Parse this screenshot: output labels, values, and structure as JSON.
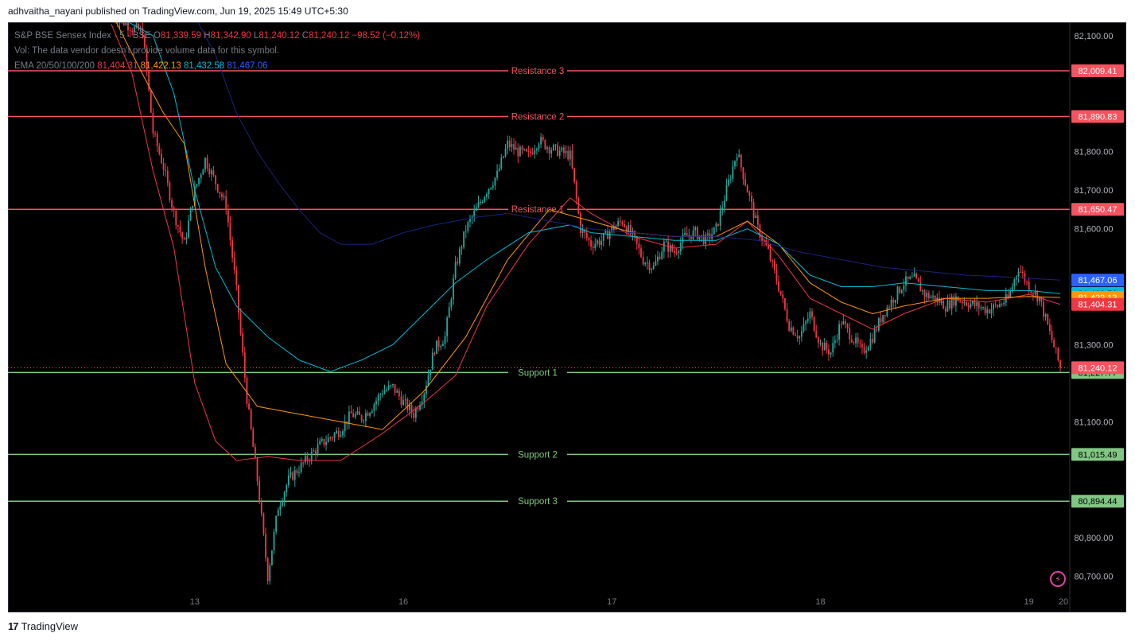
{
  "header": {
    "published_by": "adhvaitha_nayani published on TradingView.com, Jun 19, 2025 15:49 UTC+5:30"
  },
  "legend": {
    "symbol": "S&P BSE Sensex Index · 5 · BSE",
    "ohlc": {
      "o": "81,339.59",
      "h": "81,342.90",
      "l": "81,240.12",
      "c": "81,240.12",
      "change": "−98.52 (−0.12%)"
    },
    "vol_note": "Vol: The data vendor doesn't provide volume data for this symbol.",
    "ema_label": "EMA 20/50/100/200",
    "ema_values": [
      "81,404.31",
      "81,422.13",
      "81,432.58",
      "81,467.06"
    ]
  },
  "footer": {
    "brand_logo": "17",
    "brand_name": "TradingView"
  },
  "colors": {
    "background": "#000000",
    "up": "#26a69a",
    "down": "#f23645",
    "resistance": "#f7525f",
    "support": "#81c784",
    "ema20": "#f23645",
    "ema50": "#ff9800",
    "ema100": "#00bcd4",
    "ema200": "#1a237e"
  },
  "chart_data": {
    "type": "candlestick",
    "title": "S&P BSE Sensex Index · 5 · BSE",
    "ylim": [
      80660,
      82135
    ],
    "y_ticks": [
      "82,100.00",
      "81,800.00",
      "81,700.00",
      "81,600.00",
      "81,300.00",
      "81,100.00",
      "80,800.00",
      "80,700.00"
    ],
    "x_ticks": [
      "13",
      "16",
      "17",
      "18",
      "19",
      "20"
    ],
    "levels": [
      {
        "name": "Resistance 3",
        "value": 82009.41,
        "label": "82,009.41",
        "kind": "resistance"
      },
      {
        "name": "Resistance 2",
        "value": 81890.83,
        "label": "81,890.83",
        "kind": "resistance"
      },
      {
        "name": "Resistance 1",
        "value": 81650.47,
        "label": "81,650.47",
        "kind": "resistance"
      },
      {
        "name": "Support 1",
        "value": 81227.77,
        "label": "81,227.77",
        "kind": "support"
      },
      {
        "name": "Support 2",
        "value": 81015.49,
        "label": "81,015.49",
        "kind": "support"
      },
      {
        "name": "Support 3",
        "value": 80894.44,
        "label": "80,894.44",
        "kind": "support"
      }
    ],
    "price_tags": [
      {
        "value": 81467.06,
        "label": "81,467.06",
        "color": "#2962ff"
      },
      {
        "value": 81432.58,
        "label": "81,432.58",
        "color": "#00bcd4"
      },
      {
        "value": 81422.13,
        "label": "81,422.13",
        "color": "#ff9800"
      },
      {
        "value": 81404.31,
        "label": "81,404.31",
        "color": "#f23645"
      },
      {
        "value": 81240.12,
        "label": "81,240.12",
        "color": "#f7525f"
      }
    ],
    "last_price": 81240.12,
    "price_path": [
      [
        0,
        82155
      ],
      [
        1,
        82140
      ],
      [
        2,
        82120
      ],
      [
        3,
        82110
      ],
      [
        4,
        81850
      ],
      [
        5,
        81760
      ],
      [
        6,
        81640
      ],
      [
        7,
        81560
      ],
      [
        8,
        81700
      ],
      [
        9,
        81780
      ],
      [
        10,
        81720
      ],
      [
        11,
        81660
      ],
      [
        12,
        81440
      ],
      [
        13,
        81160
      ],
      [
        14,
        80950
      ],
      [
        15,
        80700
      ],
      [
        16,
        80880
      ],
      [
        17,
        80950
      ],
      [
        18,
        80980
      ],
      [
        19,
        81010
      ],
      [
        20,
        81040
      ],
      [
        21,
        81060
      ],
      [
        22,
        81080
      ],
      [
        23,
        81120
      ],
      [
        24,
        81110
      ],
      [
        25,
        81140
      ],
      [
        26,
        81180
      ],
      [
        27,
        81190
      ],
      [
        28,
        81150
      ],
      [
        29,
        81120
      ],
      [
        30,
        81180
      ],
      [
        31,
        81290
      ],
      [
        32,
        81320
      ],
      [
        33,
        81500
      ],
      [
        34,
        81600
      ],
      [
        35,
        81650
      ],
      [
        36,
        81700
      ],
      [
        37,
        81740
      ],
      [
        38,
        81820
      ],
      [
        39,
        81800
      ],
      [
        40,
        81790
      ],
      [
        41,
        81830
      ],
      [
        42,
        81810
      ],
      [
        43,
        81800
      ],
      [
        44,
        81790
      ],
      [
        45,
        81600
      ],
      [
        46,
        81560
      ],
      [
        47,
        81570
      ],
      [
        48,
        81600
      ],
      [
        49,
        81620
      ],
      [
        50,
        81580
      ],
      [
        51,
        81520
      ],
      [
        52,
        81500
      ],
      [
        53,
        81560
      ],
      [
        54,
        81540
      ],
      [
        55,
        81580
      ],
      [
        56,
        81590
      ],
      [
        57,
        81570
      ],
      [
        58,
        81600
      ],
      [
        59,
        81700
      ],
      [
        60,
        81800
      ],
      [
        61,
        81700
      ],
      [
        62,
        81600
      ],
      [
        63,
        81540
      ],
      [
        64,
        81450
      ],
      [
        65,
        81350
      ],
      [
        66,
        81320
      ],
      [
        67,
        81380
      ],
      [
        68,
        81300
      ],
      [
        69,
        81280
      ],
      [
        70,
        81360
      ],
      [
        71,
        81320
      ],
      [
        72,
        81280
      ],
      [
        73,
        81320
      ],
      [
        74,
        81380
      ],
      [
        75,
        81420
      ],
      [
        76,
        81460
      ],
      [
        77,
        81470
      ],
      [
        78,
        81430
      ],
      [
        79,
        81420
      ],
      [
        80,
        81400
      ],
      [
        81,
        81420
      ],
      [
        82,
        81410
      ],
      [
        83,
        81400
      ],
      [
        84,
        81390
      ],
      [
        85,
        81400
      ],
      [
        86,
        81420
      ],
      [
        87,
        81500
      ],
      [
        88,
        81450
      ],
      [
        89,
        81420
      ],
      [
        90,
        81330
      ],
      [
        91,
        81240.12
      ]
    ],
    "ema_series": [
      {
        "name": "EMA 20",
        "color": "#f23645",
        "values": [
          [
            0,
            82130
          ],
          [
            2,
            82000
          ],
          [
            4,
            81750
          ],
          [
            6,
            81550
          ],
          [
            8,
            81200
          ],
          [
            10,
            81050
          ],
          [
            12,
            81000
          ],
          [
            15,
            81010
          ],
          [
            18,
            81000
          ],
          [
            22,
            81000
          ],
          [
            26,
            81070
          ],
          [
            30,
            81150
          ],
          [
            33,
            81220
          ],
          [
            36,
            81400
          ],
          [
            40,
            81560
          ],
          [
            44,
            81680
          ],
          [
            46,
            81640
          ],
          [
            50,
            81580
          ],
          [
            54,
            81550
          ],
          [
            58,
            81560
          ],
          [
            61,
            81620
          ],
          [
            64,
            81530
          ],
          [
            67,
            81420
          ],
          [
            70,
            81380
          ],
          [
            73,
            81340
          ],
          [
            76,
            81380
          ],
          [
            80,
            81420
          ],
          [
            84,
            81410
          ],
          [
            88,
            81430
          ],
          [
            91,
            81404
          ]
        ]
      },
      {
        "name": "EMA 50",
        "color": "#ff9800",
        "values": [
          [
            0,
            82160
          ],
          [
            3,
            82000
          ],
          [
            5,
            81900
          ],
          [
            7,
            81820
          ],
          [
            9,
            81500
          ],
          [
            11,
            81250
          ],
          [
            14,
            81140
          ],
          [
            18,
            81120
          ],
          [
            22,
            81100
          ],
          [
            26,
            81080
          ],
          [
            30,
            81180
          ],
          [
            34,
            81320
          ],
          [
            38,
            81520
          ],
          [
            42,
            81650
          ],
          [
            46,
            81620
          ],
          [
            50,
            81590
          ],
          [
            54,
            81580
          ],
          [
            58,
            81580
          ],
          [
            61,
            81620
          ],
          [
            64,
            81560
          ],
          [
            67,
            81460
          ],
          [
            70,
            81410
          ],
          [
            73,
            81380
          ],
          [
            76,
            81400
          ],
          [
            80,
            81420
          ],
          [
            84,
            81420
          ],
          [
            88,
            81425
          ],
          [
            91,
            81422
          ]
        ]
      },
      {
        "name": "EMA 100",
        "color": "#00bcd4",
        "values": [
          [
            0,
            82160
          ],
          [
            4,
            82100
          ],
          [
            6,
            81950
          ],
          [
            8,
            81700
          ],
          [
            10,
            81500
          ],
          [
            12,
            81400
          ],
          [
            15,
            81320
          ],
          [
            18,
            81260
          ],
          [
            21,
            81230
          ],
          [
            24,
            81260
          ],
          [
            27,
            81300
          ],
          [
            30,
            81380
          ],
          [
            33,
            81460
          ],
          [
            36,
            81520
          ],
          [
            40,
            81590
          ],
          [
            44,
            81610
          ],
          [
            46,
            81590
          ],
          [
            50,
            81580
          ],
          [
            54,
            81570
          ],
          [
            58,
            81570
          ],
          [
            61,
            81600
          ],
          [
            64,
            81560
          ],
          [
            67,
            81480
          ],
          [
            70,
            81450
          ],
          [
            73,
            81450
          ],
          [
            76,
            81460
          ],
          [
            80,
            81450
          ],
          [
            84,
            81440
          ],
          [
            88,
            81440
          ],
          [
            91,
            81432
          ]
        ]
      },
      {
        "name": "EMA 200",
        "color": "#1a237e",
        "values": [
          [
            0,
            82160
          ],
          [
            8,
            82150
          ],
          [
            10,
            82050
          ],
          [
            12,
            81900
          ],
          [
            14,
            81800
          ],
          [
            16,
            81720
          ],
          [
            18,
            81650
          ],
          [
            20,
            81590
          ],
          [
            22,
            81560
          ],
          [
            25,
            81560
          ],
          [
            28,
            81590
          ],
          [
            31,
            81610
          ],
          [
            35,
            81630
          ],
          [
            38,
            81640
          ],
          [
            42,
            81620
          ],
          [
            46,
            81600
          ],
          [
            50,
            81590
          ],
          [
            54,
            81580
          ],
          [
            58,
            81580
          ],
          [
            62,
            81570
          ],
          [
            66,
            81540
          ],
          [
            70,
            81520
          ],
          [
            74,
            81500
          ],
          [
            78,
            81490
          ],
          [
            82,
            81480
          ],
          [
            86,
            81475
          ],
          [
            91,
            81467
          ]
        ]
      }
    ]
  }
}
